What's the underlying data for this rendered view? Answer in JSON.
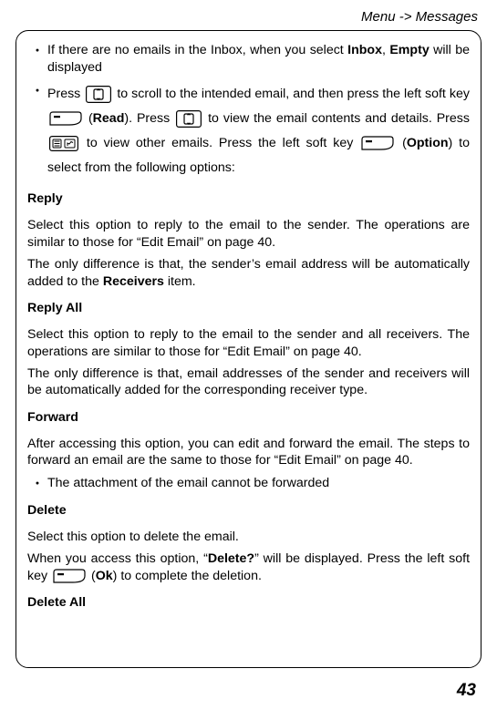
{
  "header": "Menu -> Messages",
  "page_number": "43",
  "bullet1": {
    "prefix": "If there are no emails in the Inbox, when you select ",
    "b1": "Inbox",
    "mid": ", ",
    "b2": "Empty",
    "suffix": " will be displayed"
  },
  "bullet2": {
    "t1": "Press ",
    "t2": " to scroll to the intended email, and then press the left soft key ",
    "t3": " (",
    "b_read": "Read",
    "t4": "). Press ",
    "t5": " to view the email contents and details. Press ",
    "t6": " to view other emails. Press the left soft key ",
    "t7": " (",
    "b_option": "Option",
    "t8": ") to select from the following options:"
  },
  "reply": {
    "heading": "Reply",
    "p1": "Select this option to reply to the email to the sender. The operations are similar to those for “Edit Email” on page 40.",
    "p2a": "The only difference is that, the sender’s email address will be automatically added to the ",
    "p2b": "Receivers",
    "p2c": " item."
  },
  "reply_all": {
    "heading": "Reply All",
    "p1": "Select this option to reply to the email to the sender and all receivers. The operations are similar to those for “Edit Email” on page 40.",
    "p2": "The only difference is that, email addresses of the sender and receivers will be automatically added for the corresponding receiver type."
  },
  "forward": {
    "heading": "Forward",
    "p1": "After accessing this option, you can edit and forward the email. The steps to forward an email are the same to those for “Edit Email” on page 40.",
    "bullet": "The attachment of the email cannot be forwarded"
  },
  "delete": {
    "heading": "Delete",
    "p1": "Select this option to delete the email.",
    "p2a": "When you access this option, “",
    "p2b": "Delete?",
    "p2c": "” will be displayed. Press the left soft key ",
    "p2d": " (",
    "p2e": "Ok",
    "p2f": ") to complete the deletion."
  },
  "delete_all": {
    "heading": "Delete All"
  }
}
